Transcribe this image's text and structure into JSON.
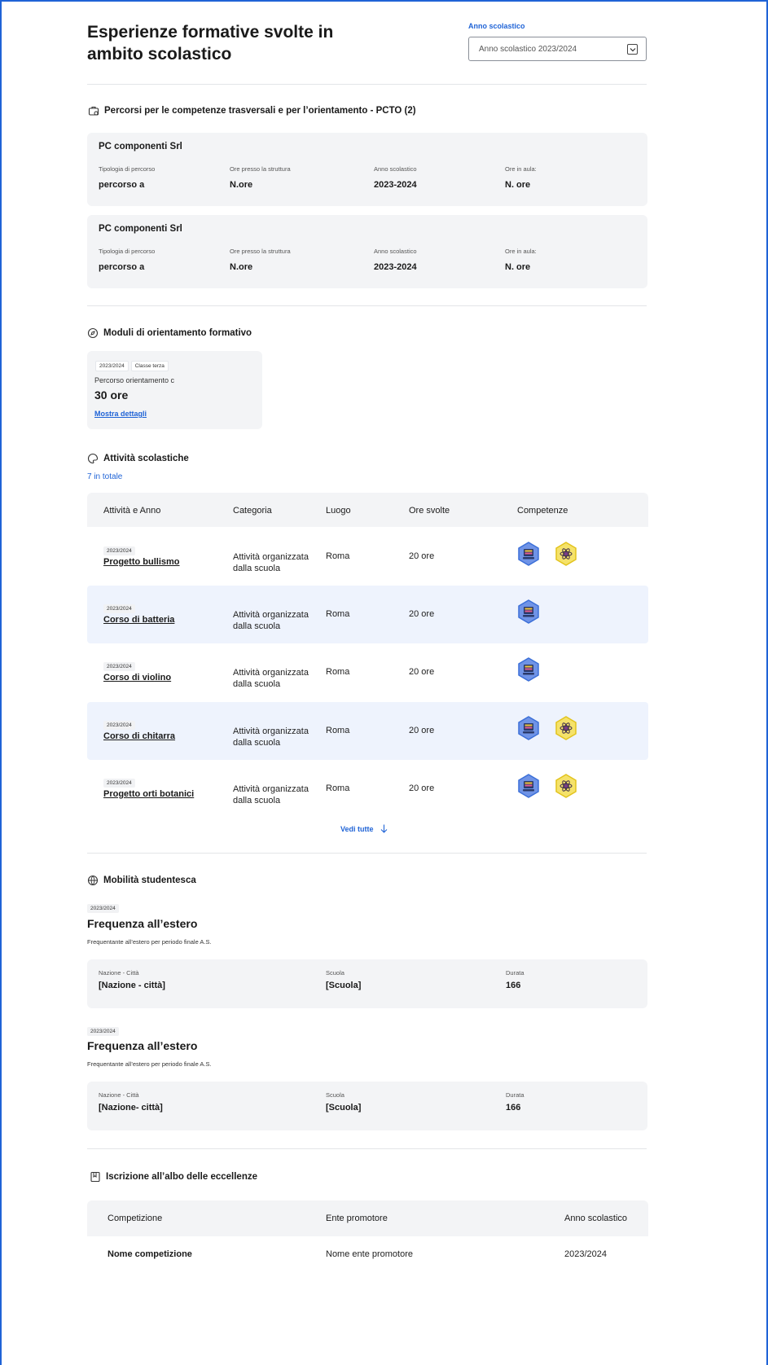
{
  "header": {
    "title_line1": "Esperienze formative svolte in",
    "title_line2": "ambito scolastico",
    "year_label": "Anno scolastico",
    "year_value": "Anno scolastico 2023/2024"
  },
  "pcto": {
    "title": "Percorsi per le competenze trasversali e per l’orientamento - PCTO (2)",
    "cards": [
      {
        "name": "PC componenti Srl",
        "l1": "Tipologia di percorso",
        "v1": "percorso a",
        "l2": "Ore presso la struttura",
        "v2": "N.ore",
        "l3": "Anno scolastico",
        "v3": "2023-2024",
        "l4": "Ore in aula:",
        "v4": "N. ore"
      },
      {
        "name": "PC componenti Srl",
        "l1": "Tipologia di percorso",
        "v1": "percorso a",
        "l2": "Ore presso la struttura",
        "v2": "N.ore",
        "l3": "Anno scolastico",
        "v3": "2023-2024",
        "l4": "Ore in aula:",
        "v4": "N. ore"
      }
    ]
  },
  "moduli": {
    "title": "Moduli di orientamento formativo",
    "chip_year": "2023/2024",
    "chip_class": "Classe terza",
    "name": "Percorso orientamento c",
    "hours": "30 ore",
    "link": "Mostra dettagli"
  },
  "attivita": {
    "title": "Attività scolastiche",
    "count": "7 in totale",
    "headers": [
      "Attività e Anno",
      "Categoria",
      "Luogo",
      "Ore svolte",
      "Competenze"
    ],
    "rows": [
      {
        "year": "2023/2024",
        "name": "Progetto bullismo",
        "cat1": "Attività organizzata",
        "cat2": "dalla scuola",
        "place": "Roma",
        "hours": "20 ore"
      },
      {
        "year": "2023/2024",
        "name": "Corso di batteria",
        "cat1": "Attività organizzata",
        "cat2": "dalla scuola",
        "place": "Roma",
        "hours": "20 ore"
      },
      {
        "year": "2023/2024",
        "name": "Corso di violino",
        "cat1": "Attività organizzata",
        "cat2": "dalla scuola",
        "place": "Roma",
        "hours": "20 ore"
      },
      {
        "year": "2023/2024",
        "name": "Corso di chitarra",
        "cat1": "Attività organizzata",
        "cat2": "dalla scuola",
        "place": "Roma",
        "hours": "20 ore"
      },
      {
        "year": "2023/2024",
        "name": "Progetto orti botanici",
        "cat1": "Attività organizzata",
        "cat2": "dalla scuola",
        "place": "Roma",
        "hours": "20 ore"
      }
    ],
    "see_all": "Vedi tutte"
  },
  "mobilita": {
    "title": "Mobilità studentesca",
    "items": [
      {
        "year": "2023/2024",
        "title": "Frequenza all’estero",
        "desc": "Frequentante all’estero per periodo finale A.S.",
        "l1": "Nazione - Città",
        "v1": "[Nazione - città]",
        "l2": "Scuola",
        "v2": "[Scuola]",
        "l3": "Durata",
        "v3": "166"
      },
      {
        "year": "2023/2024",
        "title": "Frequenza all’estero",
        "desc": "Frequentante all’estero per periodo finale A.S.",
        "l1": "Nazione - Città",
        "v1": "[Nazione- città]",
        "l2": "Scuola",
        "v2": "[Scuola]",
        "l3": "Durata",
        "v3": "166"
      }
    ]
  },
  "albo": {
    "title": "Iscrizione all’albo delle eccellenze",
    "headers": [
      "Competizione",
      "Ente promotore",
      "Anno scolastico"
    ],
    "row": [
      "Nome competizione",
      "Nome ente promotore",
      "2023/2024"
    ]
  },
  "colors": {
    "accent": "#1f63d6",
    "card_bg": "#f3f4f6",
    "row_highlight": "#eef3fd",
    "badge_blue": "#3b6fd8",
    "badge_yellow": "#f2d335"
  }
}
